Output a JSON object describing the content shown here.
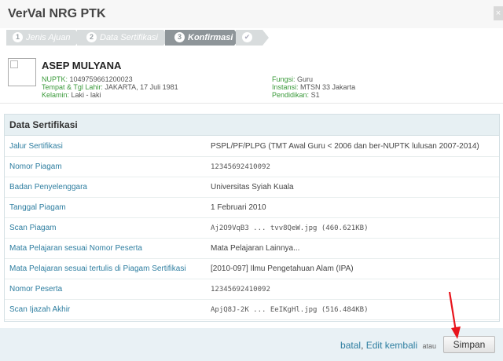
{
  "window": {
    "title": "VerVal NRG PTK",
    "close_label": "×"
  },
  "steps": [
    {
      "num": "1",
      "label": "Jenis Ajuan",
      "state": "done"
    },
    {
      "num": "2",
      "label": "Data Sertifikasi",
      "state": "done"
    },
    {
      "num": "3",
      "label": "Konfirmasi",
      "state": "active"
    },
    {
      "num": "",
      "label": "",
      "state": "pending",
      "icon": "check-icon"
    }
  ],
  "profile": {
    "name": "ASEP MULYANA",
    "nuptk_label": "NUPTK:",
    "nuptk": "1049759661200023",
    "ttl_label": "Tempat & Tgl Lahir:",
    "ttl": "JAKARTA, 17 Juli 1981",
    "kelamin_label": "Kelamin:",
    "kelamin": "Laki - laki",
    "fungsi_label": "Fungsi:",
    "fungsi": "Guru",
    "instansi_label": "Instansi:",
    "instansi": "MTSN 33 Jakarta",
    "pendidikan_label": "Pendidikan:",
    "pendidikan": "S1"
  },
  "section": {
    "title": "Data Sertifikasi",
    "rows": [
      {
        "label": "Jalur Sertifikasi",
        "value": "PSPL/PF/PLPG (TMT Awal Guru < 2006 dan ber-NUPTK lulusan 2007-2014)",
        "mono": false
      },
      {
        "label": "Nomor Piagam",
        "value": "12345692410092",
        "mono": true
      },
      {
        "label": "Badan Penyelenggara",
        "value": "Universitas Syiah Kuala",
        "mono": false
      },
      {
        "label": "Tanggal Piagam",
        "value": "1 Februari 2010",
        "mono": false
      },
      {
        "label": "Scan Piagam",
        "value": "Aj2O9VqB3 ... tvv8QeW.jpg (460.621KB)",
        "mono": true
      },
      {
        "label": "Mata Pelajaran sesuai Nomor Peserta",
        "value": "Mata Pelajaran Lainnya...",
        "mono": false
      },
      {
        "label": "Mata Pelajaran sesuai tertulis di Piagam Sertifikasi",
        "value": "[2010-097] Ilmu Pengetahuan Alam (IPA)",
        "mono": false
      },
      {
        "label": "Nomor Peserta",
        "value": "12345692410092",
        "mono": true
      },
      {
        "label": "Scan Ijazah Akhir",
        "value": "ApjQ8J-2K ... EeIKgHl.jpg (516.484KB)",
        "mono": true
      }
    ]
  },
  "footer": {
    "batal": "batal",
    "sep": ",",
    "edit": "Edit kembali",
    "atau": "atau",
    "simpan": "Simpan"
  },
  "colors": {
    "link": "#2e7ea0",
    "header_bg": "#e7f0f3",
    "footer_bg": "#e9f1f5",
    "annotation_arrow": "#e8141c"
  }
}
